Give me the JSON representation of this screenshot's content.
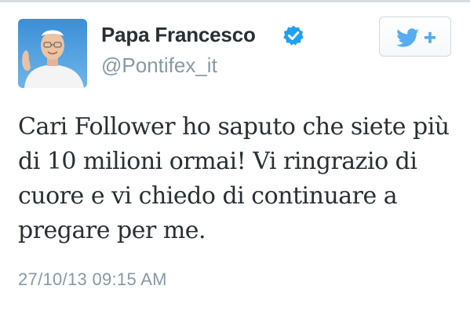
{
  "author": {
    "display_name": "Papa Francesco",
    "handle": "@Pontifex_it",
    "avatar": "profile-photo",
    "verified": true
  },
  "follow_button": {
    "icon": "twitter-bird-plus-icon",
    "accent_color": "#55acee"
  },
  "tweet": {
    "text": "Cari Follower ho saputo che siete più di 10 milioni ormai! Vi ringrazio di cuore e vi chiedo di continuare a pregare per me.",
    "timestamp": "27/10/13 09:15 AM"
  },
  "colors": {
    "text": "#292f33",
    "muted": "#8899a6",
    "verified": "#1da1f2"
  }
}
